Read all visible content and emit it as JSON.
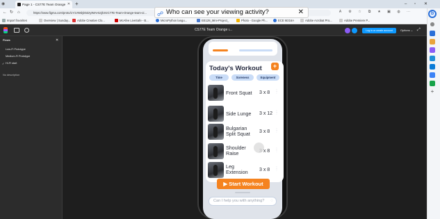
{
  "browser": {
    "tab_title": "Page 1 - CS77E Team Orange",
    "new_tab": "+",
    "url": "https://www.figma.com/proto/1Y1VWdyk53zyIMAH1QbXzC77E-Team-Orange-team-oi...",
    "win_min": "–",
    "win_max": "▫",
    "win_close": "✕",
    "favorites": [
      "Import favorites",
      "Overview | Sunday...",
      "Adobe Creative Clo...",
      "McAfee LiveSafe - B...",
      "MicroPython langu...",
      "EE128_Mini-Project_",
      "Photo - Google Ph...",
      "ECE M216A",
      "Adobe Acrobat Pro...",
      "Adobe Premiere P..."
    ]
  },
  "tooltip": {
    "text": "Who can see your viewing activity?",
    "close": "✕"
  },
  "figma": {
    "title": "CS77E Team Orange ι...",
    "login_button": "Log in or create account",
    "options": "Options ⌄",
    "panel_header": "Flows",
    "flows": [
      "Low-Fi Prototype",
      "Medium-Fi Prototype",
      "Hi-Fi start"
    ],
    "description": "No description"
  },
  "app": {
    "workout_title": "Today's Workout",
    "add_label": "+",
    "filters": [
      "Time",
      "Soreness",
      "Equipment"
    ],
    "exercises": [
      {
        "name": "Front Squat",
        "sets": "3 x 8"
      },
      {
        "name": "Side Lunge",
        "sets": "3 x 12"
      },
      {
        "name": "Bulgarian Split Squat",
        "sets": "3 x 8"
      },
      {
        "name": "Shoulder Raise",
        "sets": "3 x 8"
      },
      {
        "name": "Leg Extension",
        "sets": "3 x 8"
      }
    ],
    "start_button": "▶  Start Workout",
    "chat_placeholder": "Can I help you with anything?"
  },
  "colors": {
    "accent": "#f5831f",
    "chip": "#c9dcf7",
    "figma_blue": "#0d99ff"
  }
}
